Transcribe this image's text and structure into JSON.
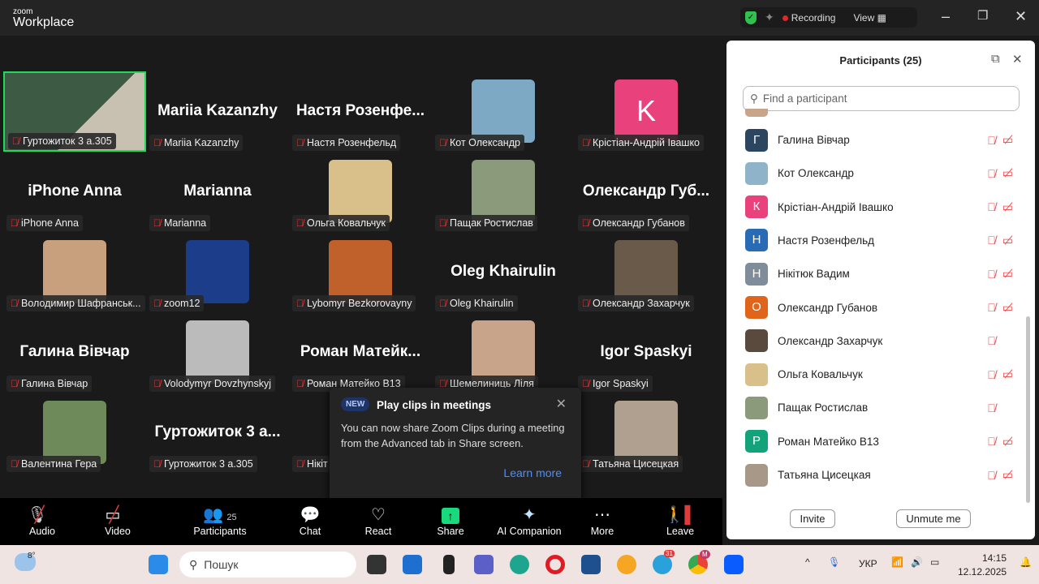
{
  "app": {
    "logo_small": "zoom",
    "logo_big": "Workplace",
    "recording": "Recording",
    "view": "View"
  },
  "tiles": [
    {
      "label": "Гуртожиток 3 а.305",
      "kind": "video",
      "active": true,
      "color": "#556b55"
    },
    {
      "label": "Mariia Kazanzhy",
      "kind": "text",
      "big": "Mariia Kazanzhy"
    },
    {
      "label": "Настя Розенфельд",
      "kind": "text",
      "big": "Настя  Розенфе..."
    },
    {
      "label": "Кот Олександр",
      "kind": "photo",
      "color": "#7ea9c4"
    },
    {
      "label": "Крістіан-Андрій Івашко",
      "kind": "letter",
      "letter": "K",
      "color": "#e8417b"
    },
    {
      "label": "iPhone Anna",
      "kind": "text",
      "big": "iPhone Anna"
    },
    {
      "label": "Marianna",
      "kind": "text",
      "big": "Marianna"
    },
    {
      "label": "Ольга Ковальчук",
      "kind": "photo",
      "color": "#d9c08a"
    },
    {
      "label": "Пащак Ростислав",
      "kind": "photo",
      "color": "#8a9a7a"
    },
    {
      "label": "Олександр Губанов",
      "kind": "text",
      "big": "Олександр  Губ..."
    },
    {
      "label": "Володимир Шафранськ...",
      "kind": "photo",
      "color": "#c9a07e"
    },
    {
      "label": "zoom12",
      "kind": "photo",
      "color": "#1b3d8a"
    },
    {
      "label": "Lybomyr Bezkorovayny",
      "kind": "photo",
      "color": "#c0602a"
    },
    {
      "label": "Oleg Khairulin",
      "kind": "text",
      "big": "Oleg Khairulin"
    },
    {
      "label": "Олександр Захарчук",
      "kind": "photo",
      "color": "#6a5a4a"
    },
    {
      "label": "Галина Вівчар",
      "kind": "text",
      "big": "Галина Вівчар"
    },
    {
      "label": "Volodymyr Dovzhynskyj",
      "kind": "photo",
      "color": "#bbbbbb"
    },
    {
      "label": "Роман Матейко В13",
      "kind": "text",
      "big": "Роман  Матейк..."
    },
    {
      "label": "Шемелиниць Ліля",
      "kind": "photo",
      "color": "#c8a48a"
    },
    {
      "label": "Igor Spaskyi",
      "kind": "text",
      "big": "Igor Spaskyi"
    },
    {
      "label": "Валентина Гера",
      "kind": "photo",
      "color": "#6f8a5a"
    },
    {
      "label": "Гуртожиток 3 а.305",
      "kind": "text",
      "big": "Гуртожиток  3  а..."
    },
    {
      "label": "Нікіт",
      "kind": "text",
      "big": ""
    },
    {
      "label": "",
      "kind": "empty"
    },
    {
      "label": "Татьяна Цисецкая",
      "kind": "photo",
      "color": "#b0a090"
    }
  ],
  "popup": {
    "badge": "NEW",
    "title": "Play clips in meetings",
    "body": "You can now share Zoom Clips during a meeting from the Advanced tab in Share screen.",
    "link": "Learn more"
  },
  "toolbar": {
    "audio": "Audio",
    "video": "Video",
    "participants": "Participants",
    "participants_count": "25",
    "chat": "Chat",
    "react": "React",
    "share": "Share",
    "ai": "AI Companion",
    "more": "More",
    "leave": "Leave"
  },
  "panel": {
    "title": "Participants (25)",
    "search_placeholder": "Find a participant",
    "invite": "Invite",
    "unmute": "Unmute me",
    "items": [
      {
        "name": "Галина Вівчар",
        "letter": "Г",
        "color": "#2c4660",
        "video": true
      },
      {
        "name": "Кот Олександр",
        "letter": "",
        "color": "#8fb3c9",
        "video": true
      },
      {
        "name": "Крістіан-Андрій Івашко",
        "letter": "К",
        "color": "#e8417b",
        "video": true
      },
      {
        "name": "Настя Розенфельд",
        "letter": "Н",
        "color": "#2a6bb5",
        "video": true
      },
      {
        "name": "Нікітюк Вадим",
        "letter": "Н",
        "color": "#7f8c99",
        "video": true
      },
      {
        "name": "Олександр Губанов",
        "letter": "О",
        "color": "#e0641a",
        "video": true
      },
      {
        "name": "Олександр Захарчук",
        "letter": "",
        "color": "#5a4a3e",
        "video": false
      },
      {
        "name": "Ольга Ковальчук",
        "letter": "",
        "color": "#d9c08a",
        "video": true
      },
      {
        "name": "Пащак Ростислав",
        "letter": "",
        "color": "#8a9a7a",
        "video": false
      },
      {
        "name": "Роман Матейко В13",
        "letter": "Р",
        "color": "#12a37a",
        "video": true
      },
      {
        "name": "Татьяна Цисецкая",
        "letter": "",
        "color": "#a89888",
        "video": true
      }
    ]
  },
  "taskbar": {
    "temp": "8°",
    "search": "Пошук",
    "lang": "УКР",
    "time": "14:15",
    "date": "12.12.2025",
    "telegram_badge": "31",
    "chrome_badge": "M"
  }
}
